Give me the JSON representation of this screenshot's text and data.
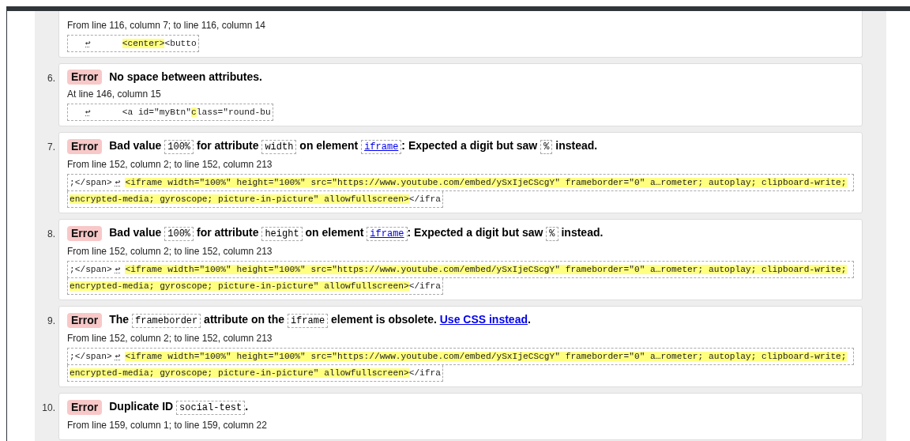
{
  "partial_message": {
    "location": "From line 116, column 7; to line 116, column 14",
    "extract": [
      [
        {
          "kind": "newline",
          "text": "↩"
        },
        {
          "kind": "highlight",
          "text": "<center>"
        },
        {
          "kind": "plain",
          "text": "<butto"
        }
      ]
    ]
  },
  "messages": [
    {
      "number": "6.",
      "badge": "Error",
      "message": [
        {
          "kind": "text",
          "text": "No space between attributes."
        }
      ],
      "location": "At line 146, column 15",
      "extract": [
        [
          {
            "kind": "newline",
            "text": "↩"
          },
          {
            "kind": "plain",
            "text": "<a id=\"myBtn\""
          },
          {
            "kind": "highlight",
            "text": "c"
          },
          {
            "kind": "plain",
            "text": "lass=\"round-bu"
          }
        ]
      ]
    },
    {
      "number": "7.",
      "badge": "Error",
      "message": [
        {
          "kind": "text",
          "text": "Bad value "
        },
        {
          "kind": "code",
          "text": "100%"
        },
        {
          "kind": "text",
          "text": " for attribute "
        },
        {
          "kind": "code",
          "text": "width"
        },
        {
          "kind": "text",
          "text": " on element "
        },
        {
          "kind": "code_link",
          "text": "iframe"
        },
        {
          "kind": "text",
          "text": ": Expected a digit but saw "
        },
        {
          "kind": "code",
          "text": "%"
        },
        {
          "kind": "text",
          "text": " instead."
        }
      ],
      "location": "From line 152, column 2; to line 152, column 213",
      "extract": [
        [
          {
            "kind": "plain",
            "text": ";</span>"
          },
          {
            "kind": "newline",
            "text": "↩"
          },
          {
            "kind": "highlight",
            "text": "<iframe width=\"100%\" height=\"100%\" src=\"https://www.youtube.com/embed/ySxIjeCScgY\" frameborder=\"0\" a…rometer; autoplay; clipboard-write;"
          }
        ],
        [
          {
            "kind": "highlight",
            "text": "encrypted-media; gyroscope; picture-in-picture\" allowfullscreen>"
          },
          {
            "kind": "plain",
            "text": "</ifra"
          }
        ]
      ]
    },
    {
      "number": "8.",
      "badge": "Error",
      "message": [
        {
          "kind": "text",
          "text": "Bad value "
        },
        {
          "kind": "code",
          "text": "100%"
        },
        {
          "kind": "text",
          "text": " for attribute "
        },
        {
          "kind": "code",
          "text": "height"
        },
        {
          "kind": "text",
          "text": " on element "
        },
        {
          "kind": "code_link",
          "text": "iframe"
        },
        {
          "kind": "text",
          "text": ": Expected a digit but saw "
        },
        {
          "kind": "code",
          "text": "%"
        },
        {
          "kind": "text",
          "text": " instead."
        }
      ],
      "location": "From line 152, column 2; to line 152, column 213",
      "extract": [
        [
          {
            "kind": "plain",
            "text": ";</span>"
          },
          {
            "kind": "newline",
            "text": "↩"
          },
          {
            "kind": "highlight",
            "text": "<iframe width=\"100%\" height=\"100%\" src=\"https://www.youtube.com/embed/ySxIjeCScgY\" frameborder=\"0\" a…rometer; autoplay; clipboard-write;"
          }
        ],
        [
          {
            "kind": "highlight",
            "text": "encrypted-media; gyroscope; picture-in-picture\" allowfullscreen>"
          },
          {
            "kind": "plain",
            "text": "</ifra"
          }
        ]
      ]
    },
    {
      "number": "9.",
      "badge": "Error",
      "message": [
        {
          "kind": "text",
          "text": "The "
        },
        {
          "kind": "code",
          "text": "frameborder"
        },
        {
          "kind": "text",
          "text": " attribute on the "
        },
        {
          "kind": "code",
          "text": "iframe"
        },
        {
          "kind": "text",
          "text": " element is obsolete. "
        },
        {
          "kind": "link",
          "text": "Use CSS instead"
        },
        {
          "kind": "text",
          "text": "."
        }
      ],
      "location": "From line 152, column 2; to line 152, column 213",
      "extract": [
        [
          {
            "kind": "plain",
            "text": ";</span>"
          },
          {
            "kind": "newline",
            "text": "↩"
          },
          {
            "kind": "highlight",
            "text": "<iframe width=\"100%\" height=\"100%\" src=\"https://www.youtube.com/embed/ySxIjeCScgY\" frameborder=\"0\" a…rometer; autoplay; clipboard-write;"
          }
        ],
        [
          {
            "kind": "highlight",
            "text": "encrypted-media; gyroscope; picture-in-picture\" allowfullscreen>"
          },
          {
            "kind": "plain",
            "text": "</ifra"
          }
        ]
      ]
    },
    {
      "number": "10.",
      "badge": "Error",
      "message": [
        {
          "kind": "text",
          "text": "Duplicate ID "
        },
        {
          "kind": "code",
          "text": "social-test"
        },
        {
          "kind": "text",
          "text": "."
        }
      ],
      "location": "From line 159, column 1; to line 159, column 22"
    }
  ]
}
